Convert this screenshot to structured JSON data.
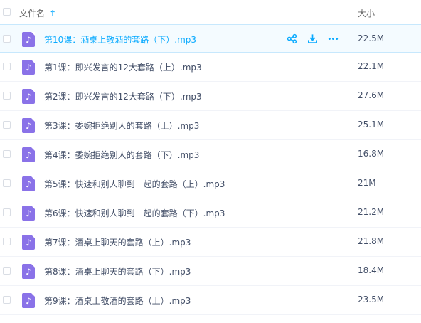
{
  "header": {
    "name_label": "文件名",
    "sort_icon": "arrow-up-icon",
    "size_label": "大小"
  },
  "colors": {
    "accent": "#09aaff",
    "music_icon": "#8a72e8",
    "selected_bg": "#f4fbff"
  },
  "files": [
    {
      "name": "第10课：酒桌上敬酒的套路（下）.mp3",
      "size": "22.5M",
      "selected": true
    },
    {
      "name": "第1课：即兴发言的12大套路（上）.mp3",
      "size": "22.1M"
    },
    {
      "name": "第2课：即兴发言的12大套路（下）.mp3",
      "size": "27.6M"
    },
    {
      "name": "第3课：委婉拒绝别人的套路（上）.mp3",
      "size": "25.1M"
    },
    {
      "name": "第4课：委婉拒绝别人的套路（下）.mp3",
      "size": "16.8M"
    },
    {
      "name": "第5课：快速和别人聊到一起的套路（上）.mp3",
      "size": "21M"
    },
    {
      "name": "第6课：快速和别人聊到一起的套路（下）.mp3",
      "size": "21.2M"
    },
    {
      "name": "第7课：酒桌上聊天的套路（上）.mp3",
      "size": "21.8M"
    },
    {
      "name": "第8课：酒桌上聊天的套路（下）.mp3",
      "size": "18.4M"
    },
    {
      "name": "第9课：酒桌上敬酒的套路（上）.mp3",
      "size": "23.5M"
    }
  ],
  "row_actions": [
    "share-icon",
    "download-icon",
    "more-icon"
  ]
}
